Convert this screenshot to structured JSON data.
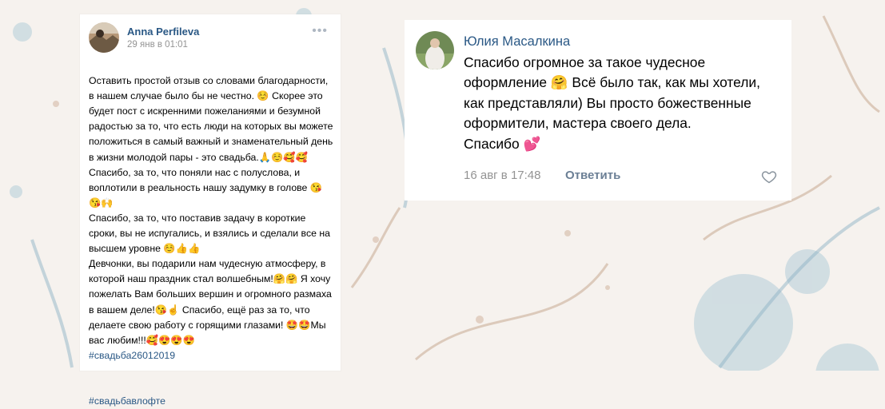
{
  "left_post": {
    "author": "Anna Perfileva",
    "date": "29 янв в 01:01",
    "more": "•••",
    "text": "Оставить простой отзыв со словами благодарности, в нашем случае было бы не честно. ☺️ Скорее это будет пост с искренними пожеланиями и безумной радостью за то, что есть люди на которых вы можете положиться в самый важный и знаменательный день в жизни молодой пары - это свадьба.🙏☺️🥰🥰\nСпасибо, за то, что поняли нас с полуслова, и воплотили в реальность  нашу задумку в голове 😘😘🙌\nСпасибо, за то, что поставив задачу в короткие сроки, вы не испугались, и взялись и сделали все на высшем уровне ☺️👍👍\nДевчонки, вы подарили нам чудесную атмосферу, в которой наш праздник стал волшебным!🤗🤗 Я хочу пожелать Вам больших вершин и огромного размаха в вашем деле!😘☝️ Спасибо,  ещё раз за то, что делаете свою работу с горящими глазами! 🤩🤩Мы вас любим!!!🥰😍😍😍",
    "hashtags": [
      "#свадьба26012019",
      "#свадьбавлофте"
    ]
  },
  "right_comment": {
    "author": "Юлия Масалкина",
    "text": "Спасибо огромное  за такое чудесное оформление 🤗 Всё было так, как мы хотели, как представляли) Вы просто божественные оформители, мастера своего дела.\n Спасибо 💕",
    "date": "16 авг в 17:48",
    "reply_label": "Ответить"
  },
  "colors": {
    "link": "#2a5885",
    "meta": "#939393",
    "background": "#f6f2ee"
  }
}
